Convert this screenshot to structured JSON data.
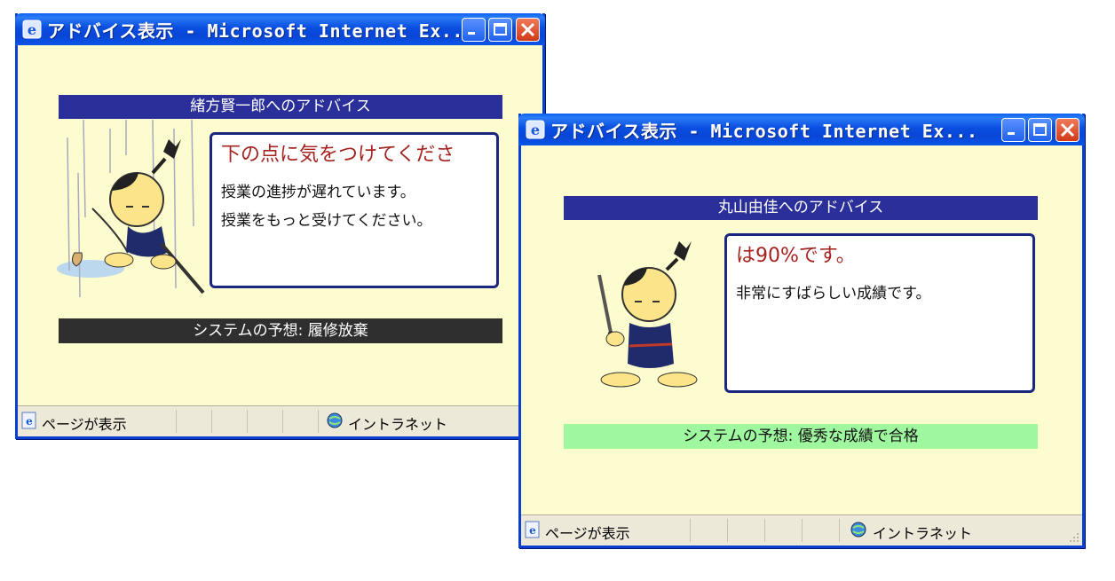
{
  "window1": {
    "title": "アドバイス表示 - Microsoft Internet Ex...",
    "heading": "緒方賢一郎へのアドバイス",
    "advice_head": "下の点に気をつけてくださ",
    "advice_lines": [
      "授業の進捗が遅れています。",
      "授業をもっと受けてください。"
    ],
    "prediction": "システムの予想: 履修放棄",
    "status_text": "ページが表示",
    "zone_text": "イントラネット",
    "colors": {
      "prediction_bg": "#2f2f2f",
      "prediction_fg": "#ffffff"
    }
  },
  "window2": {
    "title": "アドバイス表示 - Microsoft Internet Ex...",
    "heading": "丸山由佳へのアドバイス",
    "advice_head": "は90%です。",
    "advice_lines": [
      "非常にすばらしい成績です。"
    ],
    "prediction": "システムの予想: 優秀な成績で合格",
    "status_text": "ページが表示",
    "zone_text": "イントラネット",
    "colors": {
      "prediction_bg": "#9ff79f",
      "prediction_fg": "#111111"
    }
  },
  "icons": [
    "ie-icon",
    "minimize-icon",
    "maximize-icon",
    "close-icon",
    "page-icon",
    "intranet-globe-icon",
    "samurai-sad-illustration",
    "samurai-happy-illustration"
  ]
}
